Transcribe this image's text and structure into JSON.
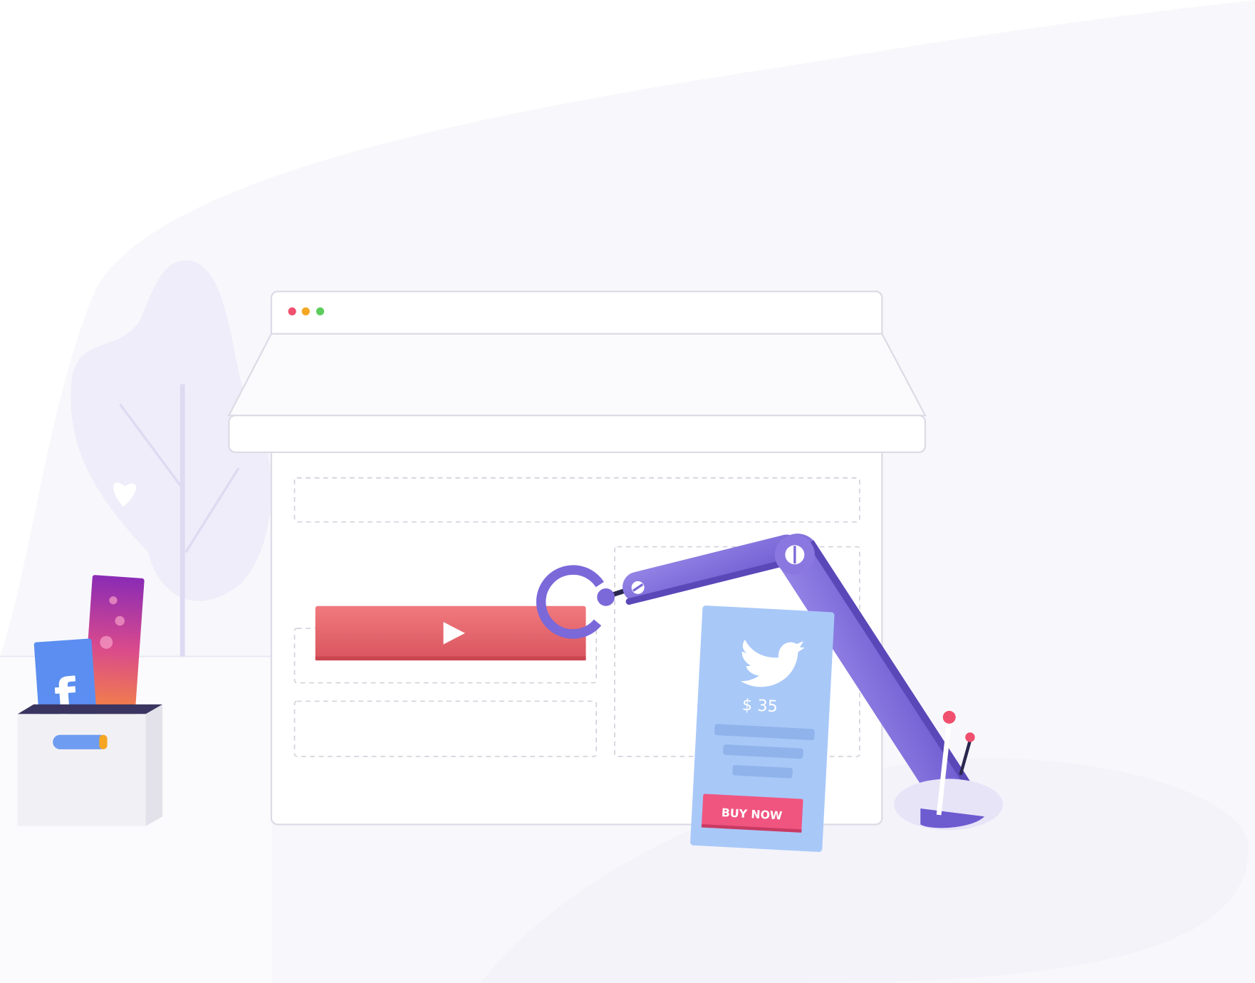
{
  "scene": {
    "browser_dots": [
      "#f0506e",
      "#f5a623",
      "#5ccc5c"
    ],
    "accent_purple": "#7b68d9",
    "video_bar_color": "#e8646c",
    "card_color": "#a8c8f8",
    "button_color": "#f05580"
  },
  "pricing_card": {
    "icon": "twitter-bird-icon",
    "price": "$ 35",
    "button_label": "BUY NOW"
  },
  "social_box": {
    "cards": [
      "facebook-icon",
      "instagram-hearts"
    ]
  },
  "video": {
    "icon": "play-icon"
  }
}
